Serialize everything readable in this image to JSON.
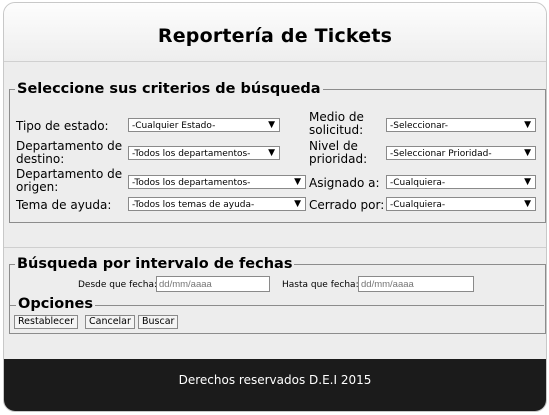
{
  "page": {
    "title": "Reportería de Tickets"
  },
  "criteria": {
    "legend": "Seleccione sus criterios de búsqueda",
    "estado": {
      "label": "Tipo de estado:",
      "value": "-Cualquier Estado-"
    },
    "medio": {
      "label_line1": "Medio de",
      "label_line2": "solicitud:",
      "value": "-Seleccionar-"
    },
    "destino": {
      "label_line1": "Departamento de",
      "label_line2": "destino:",
      "value": "-Todos los departamentos-"
    },
    "prioridad": {
      "label_line1": "Nivel de",
      "label_line2": "prioridad:",
      "value": "-Seleccionar Prioridad-"
    },
    "origen": {
      "label_line1": "Departamento de",
      "label_line2": "origen:",
      "value": "-Todos los departamentos-"
    },
    "asignado": {
      "label": "Asignado a:",
      "value": "-Cualquiera-"
    },
    "tema": {
      "label": "Tema de ayuda:",
      "value": "-Todos los temas de ayuda-"
    },
    "cerrado": {
      "label": "Cerrado por:",
      "value": "-Cualquiera-"
    }
  },
  "dates": {
    "legend": "Búsqueda por intervalo de fechas",
    "from_label": "Desde que fecha:",
    "from_placeholder": "dd/mm/aaaa",
    "to_label": "Hasta que fecha:",
    "to_placeholder": "dd/mm/aaaa"
  },
  "options": {
    "legend": "Opciones",
    "reset": "Restablecer",
    "cancel": "Cancelar",
    "search": "Buscar"
  },
  "footer": {
    "text": "Derechos reservados D.E.I 2015"
  },
  "icons": {
    "dropdown_arrow": "▼"
  }
}
